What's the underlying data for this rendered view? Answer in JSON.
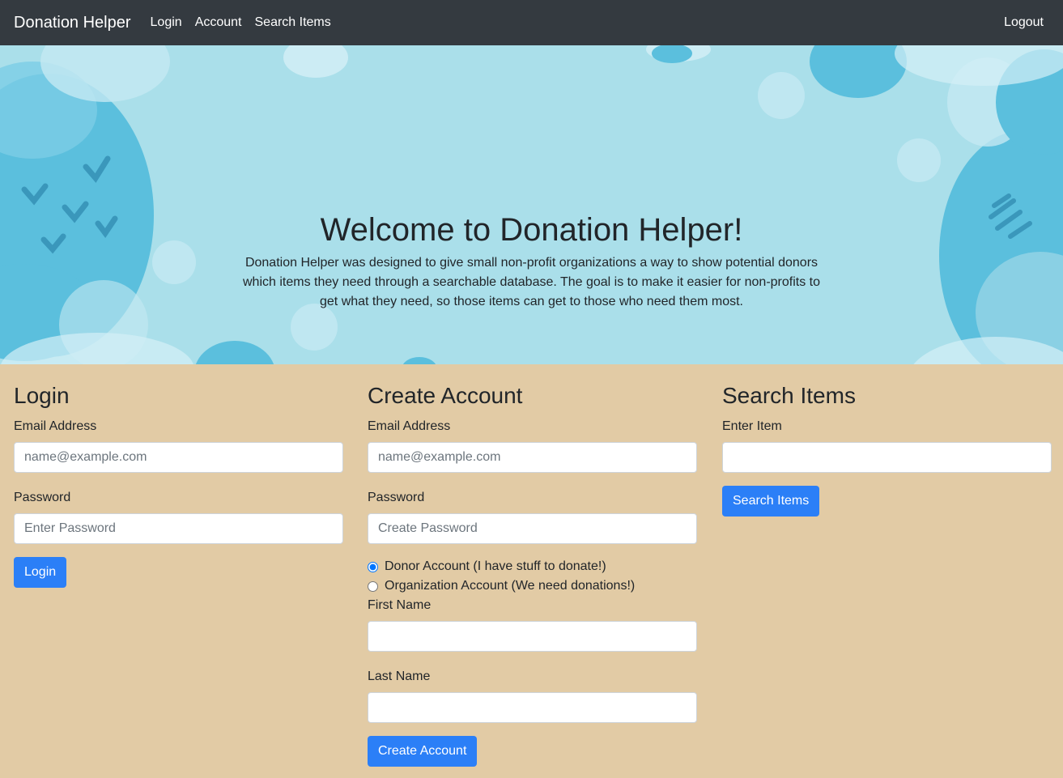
{
  "nav": {
    "brand": "Donation Helper",
    "links": [
      "Login",
      "Account",
      "Search Items"
    ],
    "logout": "Logout"
  },
  "hero": {
    "title": "Welcome to Donation Helper!",
    "description_lines": [
      "Donation Helper was designed to give small non-profit organizations a way to show potential donors",
      "which items they need through a searchable database. The goal is to make it easier for non-profits to",
      "get what they need, so those items can get to those who need them most."
    ]
  },
  "login": {
    "heading": "Login",
    "email_label": "Email Address",
    "email_placeholder": "name@example.com",
    "password_label": "Password",
    "password_placeholder": "Enter Password",
    "button": "Login"
  },
  "create": {
    "heading": "Create Account",
    "email_label": "Email Address",
    "email_placeholder": "name@example.com",
    "password_label": "Password",
    "password_placeholder": "Create Password",
    "radio_donor": "Donor Account (I have stuff to donate!)",
    "radio_org": "Organization Account (We need donations!)",
    "first_name_label": "First Name",
    "last_name_label": "Last Name",
    "button": "Create Account"
  },
  "search": {
    "heading": "Search Items",
    "item_label": "Enter Item",
    "button": "Search Items"
  },
  "colors": {
    "navbar": "#343a40",
    "hero_bg": "#aadfea",
    "hero_blob": "#5bbfdd",
    "form_bg": "#e2cba5",
    "primary": "#2b7ff7"
  }
}
